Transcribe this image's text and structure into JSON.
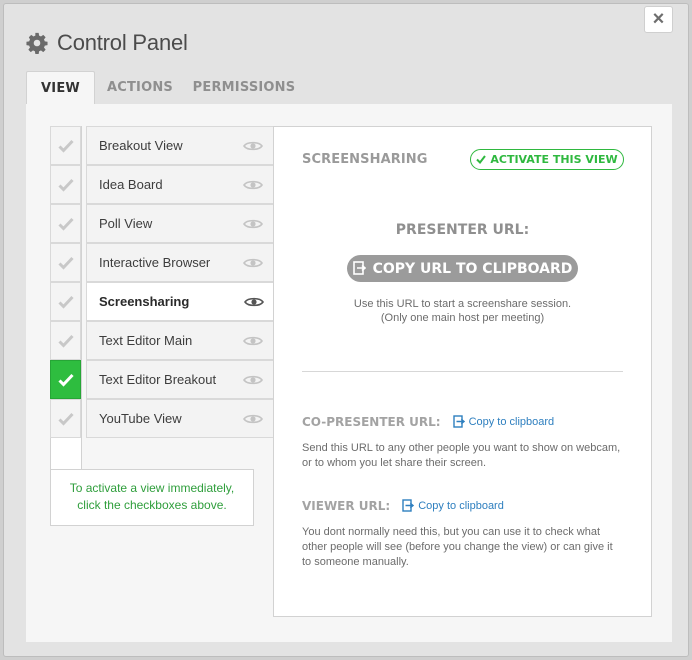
{
  "window": {
    "title": "Control Panel",
    "close_label": "×"
  },
  "tabs": [
    {
      "label": "VIEW",
      "active": true
    },
    {
      "label": "ACTIONS",
      "active": false
    },
    {
      "label": "PERMISSIONS",
      "active": false
    }
  ],
  "views": [
    {
      "label": "Breakout View",
      "checked": false
    },
    {
      "label": "Idea Board",
      "checked": false
    },
    {
      "label": "Poll View",
      "checked": false
    },
    {
      "label": "Interactive Browser",
      "checked": false
    },
    {
      "label": "Screensharing",
      "checked": false,
      "selected": true
    },
    {
      "label": "Text Editor Main",
      "checked": false
    },
    {
      "label": "Text Editor Breakout",
      "checked": true
    },
    {
      "label": "YouTube View",
      "checked": false
    }
  ],
  "hint": {
    "line1": "To activate a view immediately,",
    "line2": "click the checkboxes above."
  },
  "detail": {
    "title": "SCREENSHARING",
    "activate_label": "ACTIVATE THIS VIEW",
    "presenter_label": "PRESENTER URL:",
    "copy_main_label": "COPY URL TO CLIPBOARD",
    "presenter_desc_line1": "Use this URL to start a screenshare session.",
    "presenter_desc_line2": "(Only one main host per meeting)",
    "copresenter_label": "CO-PRESENTER URL:",
    "copresenter_link": "Copy to clipboard",
    "copresenter_desc_line1": "Send this URL to any other people you want to show on webcam,",
    "copresenter_desc_line2": "or to whom you let share their screen.",
    "viewer_label": "VIEWER URL:",
    "viewer_link": "Copy to clipboard",
    "viewer_desc_line1": "You dont normally need this, but you can use it to check what",
    "viewer_desc_line2": "other people will see (before you change the view) or can give it",
    "viewer_desc_line3": "to someone manually."
  },
  "colors": {
    "accent_green": "#2ebd3f",
    "link_blue": "#2e7fbf",
    "button_gray": "#9b9b9b"
  },
  "icons": {
    "title": "gear-icon",
    "close": "close-icon",
    "checkbox": "checkmark-icon",
    "visibility": "eye-icon",
    "copy": "clipboard-icon"
  }
}
